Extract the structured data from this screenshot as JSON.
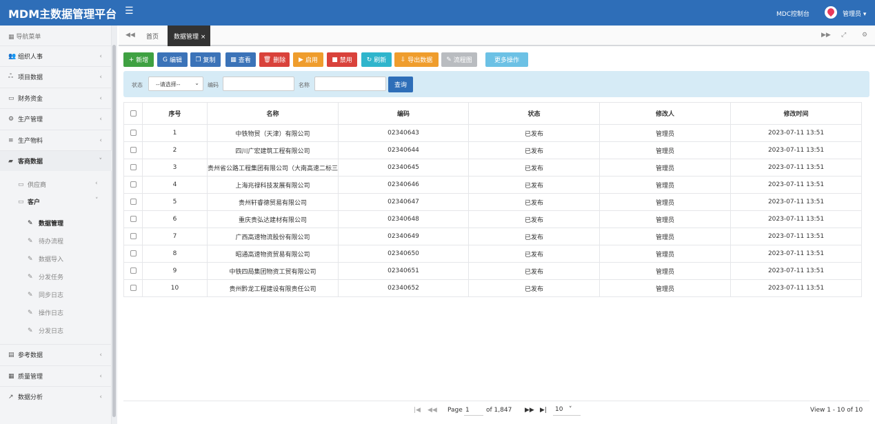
{
  "header": {
    "title": "MDM主数据管理平台",
    "menu_icon": "☰",
    "mdc_link": "MDC控制台",
    "user": "管理员 ▾"
  },
  "sidebar": {
    "nav_title": "导航菜单",
    "items": [
      {
        "label": "组织人事",
        "icon": "👥",
        "arrow": "‹"
      },
      {
        "label": "项目数据",
        "icon": "ஃ",
        "arrow": "‹"
      },
      {
        "label": "财务资金",
        "icon": "▭",
        "arrow": "‹"
      },
      {
        "label": "生产管理",
        "icon": "⚙",
        "arrow": "‹"
      },
      {
        "label": "生产物料",
        "icon": "≡",
        "arrow": "‹"
      },
      {
        "label": "客商数据",
        "icon": "▰",
        "arrow": "˅"
      },
      {
        "label": "参考数据",
        "icon": "▤",
        "arrow": "‹"
      },
      {
        "label": "质量管理",
        "icon": "▦",
        "arrow": "‹"
      },
      {
        "label": "数据分析",
        "icon": "↗",
        "arrow": "‹"
      }
    ],
    "sub_items": [
      {
        "label": "供应商",
        "icon": "▭",
        "arrow": "‹"
      },
      {
        "label": "客户",
        "icon": "▭",
        "arrow": "˅"
      }
    ],
    "leaves": [
      "数据管理",
      "待办流程",
      "数据导入",
      "分发任务",
      "同步日志",
      "操作日志",
      "分发日志"
    ],
    "leaf_icon": "✎"
  },
  "tabs": {
    "prev": "◀◀",
    "home": "首页",
    "active": "数据管理 ×",
    "next": "▶▶",
    "fullscreen": "⤢",
    "settings": "⚙"
  },
  "toolbar": {
    "buttons": [
      {
        "label": "新增",
        "icon": "+",
        "color": "#3fa142"
      },
      {
        "label": "编辑",
        "icon": "G",
        "color": "#3b73b8"
      },
      {
        "label": "复制",
        "icon": "❐",
        "color": "#3b73b8"
      },
      {
        "label": "查看",
        "icon": "▦",
        "color": "#3b73b8"
      },
      {
        "label": "删除",
        "icon": "🗑",
        "color": "#d9423b"
      },
      {
        "label": "启用",
        "icon": "▶",
        "color": "#ef9d2d"
      },
      {
        "label": "禁用",
        "icon": "■",
        "color": "#d9423b"
      },
      {
        "label": "刷新",
        "icon": "↻",
        "color": "#2fb5cc"
      },
      {
        "label": "导出数据",
        "icon": "⇩",
        "color": "#ef9d2d"
      },
      {
        "label": "流程图",
        "icon": "✎",
        "color": "#b9bcc0"
      },
      {
        "label": "更多操作",
        "icon": "",
        "color": "#6cc1e5"
      }
    ]
  },
  "filter": {
    "status_label": "状态",
    "status_value": "--请选择--",
    "code_label": "编码",
    "code_value": "",
    "name_label": "名称",
    "name_value": "",
    "query_button": "查询"
  },
  "table": {
    "headers": [
      "序号",
      "名称",
      "编码",
      "状态",
      "修改人",
      "修改时间"
    ],
    "rows": [
      [
        "1",
        "中铁物贸（天津）有限公司",
        "02340643",
        "已发布",
        "管理员",
        "2023-07-11 13:51"
      ],
      [
        "2",
        "四川广宏建筑工程有限公司",
        "02340644",
        "已发布",
        "管理员",
        "2023-07-11 13:51"
      ],
      [
        "3",
        "贵州省公路工程集团有限公司（大南高速二标三",
        "02340645",
        "已发布",
        "管理员",
        "2023-07-11 13:51"
      ],
      [
        "4",
        "上海兆禄科技发展有限公司",
        "02340646",
        "已发布",
        "管理员",
        "2023-07-11 13:51"
      ],
      [
        "5",
        "贵州轩睿德贸易有限公司",
        "02340647",
        "已发布",
        "管理员",
        "2023-07-11 13:51"
      ],
      [
        "6",
        "重庆贵弘达建材有限公司",
        "02340648",
        "已发布",
        "管理员",
        "2023-07-11 13:51"
      ],
      [
        "7",
        "广西高速物流股份有限公司",
        "02340649",
        "已发布",
        "管理员",
        "2023-07-11 13:51"
      ],
      [
        "8",
        "昭通高速物资贸易有限公司",
        "02340650",
        "已发布",
        "管理员",
        "2023-07-11 13:51"
      ],
      [
        "9",
        "中铁四局集团物资工贸有限公司",
        "02340651",
        "已发布",
        "管理员",
        "2023-07-11 13:51"
      ],
      [
        "10",
        "贵州黔龙工程建设有限责任公司",
        "02340652",
        "已发布",
        "管理员",
        "2023-07-11 13:51"
      ]
    ]
  },
  "pager": {
    "first": "|◀",
    "prev": "◀◀",
    "page_label": "Page",
    "page_value": "1",
    "of_label": "of 1,847",
    "next": "▶▶",
    "last": "▶|",
    "page_size": "10",
    "page_size_caret": "˅",
    "view_info": "View 1 - 10 of 10"
  }
}
